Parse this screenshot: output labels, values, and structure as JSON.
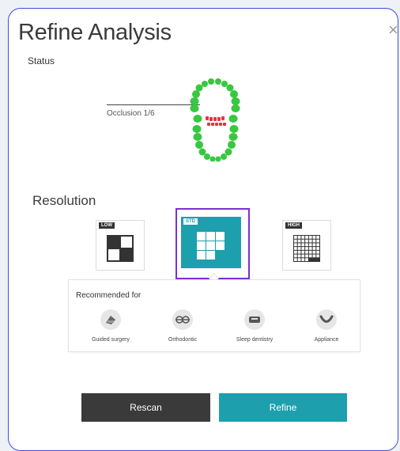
{
  "dialog": {
    "title": "Refine Analysis",
    "close_glyph": "×"
  },
  "status": {
    "label": "Status",
    "occlusion_label": "Occlusion 1/6"
  },
  "resolution": {
    "title": "Resolution",
    "options": [
      {
        "tag": "LOW",
        "selected": false
      },
      {
        "tag": "STD",
        "selected": true
      },
      {
        "tag": "HIGH",
        "selected": false
      }
    ]
  },
  "recommended": {
    "title": "Recommended for",
    "items": [
      {
        "label": "Guided surgery",
        "icon": "guided-surgery-icon"
      },
      {
        "label": "Orthodontic",
        "icon": "orthodontic-icon"
      },
      {
        "label": "Sleep dentistry",
        "icon": "sleep-dentistry-icon"
      },
      {
        "label": "Appliance",
        "icon": "appliance-icon"
      }
    ]
  },
  "buttons": {
    "rescan": "Rescan",
    "refine": "Refine"
  },
  "colors": {
    "accent": "#1d9fad",
    "dark_button": "#3a3a3a",
    "selection_outline": "#7a2fd3",
    "tooth_ok": "#37c83f",
    "tooth_occlusion": "#e6343c"
  }
}
